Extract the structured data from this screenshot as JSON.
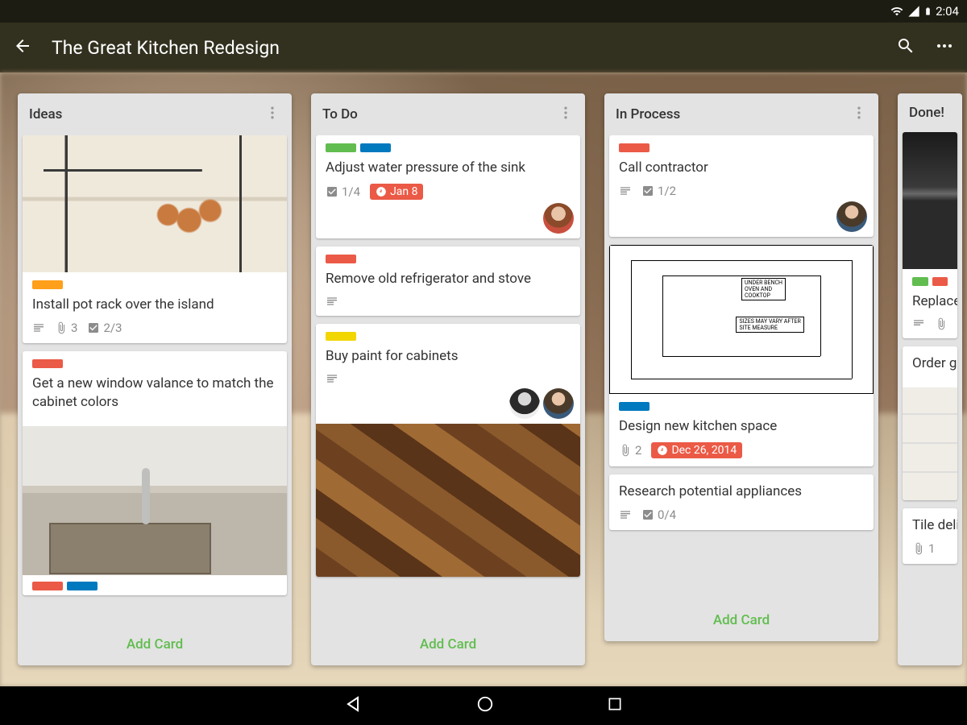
{
  "status": {
    "time": "2:04"
  },
  "appbar": {
    "title": "The Great Kitchen Redesign"
  },
  "add_card_label": "Add Card",
  "lists": [
    {
      "title": "Ideas",
      "cards": [
        {
          "title": "Install pot rack over the island",
          "attach": "3",
          "check": "2/3"
        },
        {
          "title": "Get a new window valance to match the cabinet colors"
        }
      ]
    },
    {
      "title": "To Do",
      "cards": [
        {
          "title": "Adjust water pressure of the sink",
          "check": "1/4",
          "due": "Jan 8"
        },
        {
          "title": "Remove old refrigerator and stove"
        },
        {
          "title": "Buy paint for cabinets"
        }
      ]
    },
    {
      "title": "In Process",
      "cards": [
        {
          "title": "Call contractor",
          "check": "1/2"
        },
        {
          "title": "Design new kitchen space",
          "attach": "2",
          "due": "Dec 26, 2014"
        },
        {
          "title": "Research potential appliances",
          "check": "0/4"
        }
      ]
    },
    {
      "title": "Done!",
      "cards": [
        {
          "title": "Replace old ones",
          "attach": ""
        },
        {
          "title": "Order gla"
        },
        {
          "title": "Tile delive",
          "attach": "1"
        }
      ]
    }
  ]
}
